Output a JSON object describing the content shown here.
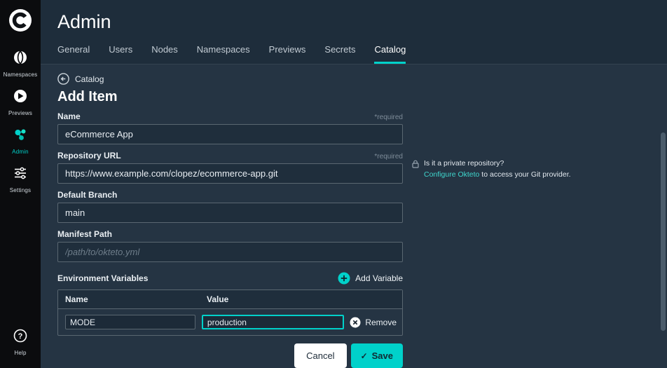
{
  "colors": {
    "accent": "#00d1ca"
  },
  "sidebar": {
    "items": [
      {
        "label": "Namespaces"
      },
      {
        "label": "Previews"
      },
      {
        "label": "Admin"
      },
      {
        "label": "Settings"
      }
    ],
    "help_label": "Help"
  },
  "header": {
    "title": "Admin",
    "tabs": [
      {
        "label": "General"
      },
      {
        "label": "Users"
      },
      {
        "label": "Nodes"
      },
      {
        "label": "Namespaces"
      },
      {
        "label": "Previews"
      },
      {
        "label": "Secrets"
      },
      {
        "label": "Catalog"
      }
    ]
  },
  "content": {
    "breadcrumb": "Catalog",
    "page_title": "Add Item",
    "fields": {
      "name": {
        "label": "Name",
        "required": "*required",
        "value": "eCommerce App"
      },
      "repo": {
        "label": "Repository URL",
        "required": "*required",
        "value": "https://www.example.com/clopez/ecommerce-app.git"
      },
      "branch": {
        "label": "Default Branch",
        "value": "main"
      },
      "manifest": {
        "label": "Manifest Path",
        "placeholder": "/path/to/okteto.yml"
      }
    },
    "private_note": {
      "line1": "Is it a private repository?",
      "link": "Configure Okteto",
      "line2_rest": " to access your Git provider."
    },
    "env": {
      "label": "Environment Variables",
      "add_button": "Add Variable",
      "table": {
        "headers": [
          "Name",
          "Value"
        ],
        "rows": [
          {
            "name": "MODE",
            "value": "production"
          }
        ]
      },
      "remove_label": "Remove"
    },
    "actions": {
      "cancel": "Cancel",
      "save": "Save"
    }
  }
}
